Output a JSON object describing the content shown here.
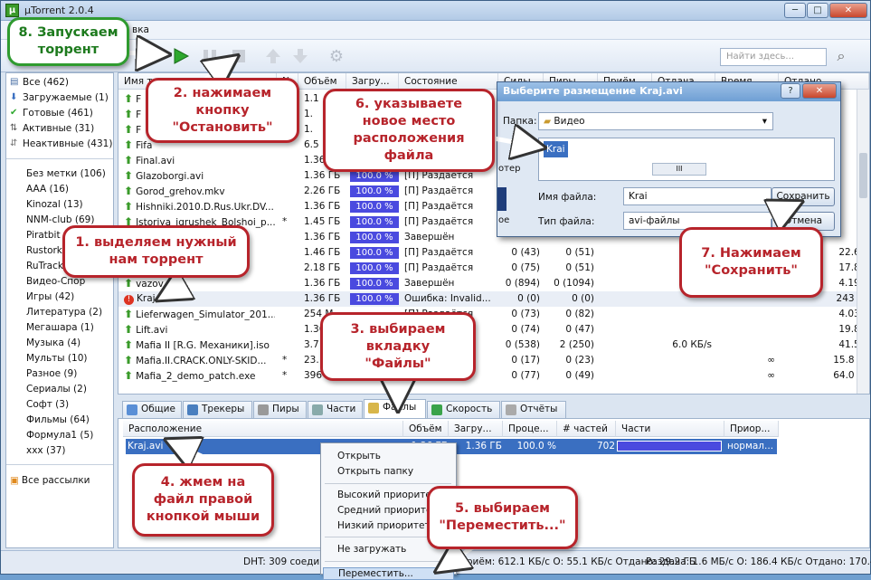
{
  "window": {
    "title": "µTorrent 2.0.4",
    "icon_letter": "μ",
    "minimize_label": "─",
    "maximize_label": "□",
    "close_label": "✕"
  },
  "menu": {
    "visible_item": "вка"
  },
  "toolbar": {
    "icons": [
      "remove-icon",
      "start-icon",
      "pause-icon",
      "stop-icon",
      "up-icon",
      "down-icon",
      "settings-icon"
    ],
    "search_placeholder": "Найти здесь...",
    "colors": {
      "start": "#2ea82e",
      "remove": "#d23a2a"
    }
  },
  "sidebar": {
    "status_items": [
      {
        "label": "Все (462)",
        "icon": "all-icon"
      },
      {
        "label": "Загружаемые (1)",
        "icon": "download-icon"
      },
      {
        "label": "Готовые (461)",
        "icon": "check-icon"
      },
      {
        "label": "Активные (31)",
        "icon": "active-icon"
      },
      {
        "label": "Неактивные (431)",
        "icon": "inactive-icon"
      }
    ],
    "label_items": [
      "Без метки (106)",
      "AAA (16)",
      "Kinozal (13)",
      "NNM-club (69)",
      "Piratbit (2",
      "Rustorka",
      "RuTracker",
      "Видео-Спор",
      "Игры (42)",
      "Литература (2)",
      "Мегашара (1)",
      "Музыка (4)",
      "Мульты (10)",
      "Разное (9)",
      "Сериалы (2)",
      "Софт (3)",
      "Фильмы (64)",
      "Формула1 (5)",
      "xxx (37)"
    ],
    "rss_label": "Все рассылки"
  },
  "torrents": {
    "headers": [
      "Имя торрента",
      "N",
      "Объём",
      "Загру...",
      "Состояние",
      "Сиды",
      "Пиры",
      "Приём",
      "Отдача",
      "Время",
      "Отдано"
    ],
    "rows": [
      {
        "name": "F",
        "num": "",
        "size": "1.1",
        "progress": "",
        "status": "",
        "seeds": "",
        "peers": "",
        "down": "",
        "up": "",
        "eta": "",
        "uploaded": "",
        "err": false
      },
      {
        "name": "F",
        "num": "",
        "size": "1.",
        "progress": "",
        "status": "",
        "seeds": "",
        "peers": "",
        "down": "",
        "up": "",
        "eta": "",
        "uploaded": "M",
        "err": false
      },
      {
        "name": "F",
        "num": "",
        "size": "1.",
        "progress": "",
        "status": "",
        "seeds": "",
        "peers": "",
        "down": "",
        "up": "",
        "eta": "",
        "uploaded": "",
        "err": false
      },
      {
        "name": "Fifa",
        "num": "",
        "size": "6.5",
        "progress": "",
        "status": "",
        "seeds": "",
        "peers": "",
        "down": "",
        "up": "",
        "eta": "",
        "uploaded": "M",
        "err": false
      },
      {
        "name": "Final.avi",
        "num": "",
        "size": "1.36 ГБ",
        "progress": "",
        "status": "",
        "seeds": "",
        "peers": "",
        "down": "",
        "up": "",
        "eta": "",
        "uploaded": "",
        "err": false
      },
      {
        "name": "Glazoborgi.avi",
        "num": "",
        "size": "1.36 ГБ",
        "progress": "100.0 %",
        "status": "[П] Раздаётся",
        "seeds": "",
        "peers": "",
        "down": "",
        "up": "",
        "eta": "",
        "uploaded": "",
        "err": false
      },
      {
        "name": "Gorod_grehov.mkv",
        "num": "",
        "size": "2.26 ГБ",
        "progress": "100.0 %",
        "status": "[П] Раздаётся",
        "seeds": "",
        "peers": "",
        "down": "",
        "up": "",
        "eta": "",
        "uploaded": "",
        "err": false
      },
      {
        "name": "Hishniki.2010.D.Rus.Ukr.DV...",
        "num": "",
        "size": "1.36 ГБ",
        "progress": "100.0 %",
        "status": "[П] Раздаётся",
        "seeds": "",
        "peers": "",
        "down": "",
        "up": "",
        "eta": "",
        "uploaded": "",
        "err": false
      },
      {
        "name": "Istoriya_igrushek_Bolshoi_p...",
        "num": "*",
        "size": "1.45 ГБ",
        "progress": "100.0 %",
        "status": "[П] Раздаётся",
        "seeds": "",
        "peers": "",
        "down": "",
        "up": "",
        "eta": "",
        "uploaded": "",
        "err": false
      },
      {
        "name": "",
        "num": "",
        "size": "1.36 ГБ",
        "progress": "100.0 %",
        "status": "Завершён",
        "seeds": "",
        "peers": "",
        "down": "",
        "up": "",
        "eta": "",
        "uploaded": "",
        "err": false
      },
      {
        "name": "",
        "num": "",
        "size": "1.46 ГБ",
        "progress": "100.0 %",
        "status": "[П] Раздаётся",
        "seeds": "0 (43)",
        "peers": "0 (51)",
        "down": "",
        "up": "",
        "eta": "",
        "uploaded": "22.6 l",
        "err": false
      },
      {
        "name": "",
        "num": "",
        "size": "2.18 ГБ",
        "progress": "100.0 %",
        "status": "[П] Раздаётся",
        "seeds": "0 (75)",
        "peers": "0 (51)",
        "down": "",
        "up": "",
        "eta": "",
        "uploaded": "17.8 l",
        "err": false
      },
      {
        "name": "vazov.avi",
        "num": "",
        "size": "1.36 ГБ",
        "progress": "100.0 %",
        "status": "Завершён",
        "seeds": "0 (894)",
        "peers": "0 (1094)",
        "down": "",
        "up": "",
        "eta": "",
        "uploaded": "4.19 l",
        "err": false
      },
      {
        "name": "Kraj.avi",
        "num": "",
        "size": "1.36 ГБ",
        "progress": "100.0 %",
        "status": "Ошибка: Invalid...",
        "seeds": "0 (0)",
        "peers": "0 (0)",
        "down": "",
        "up": "",
        "eta": "",
        "uploaded": "243 M",
        "err": true
      },
      {
        "name": "Lieferwagen_Simulator_201...",
        "num": "",
        "size": "254 M",
        "progress": "",
        "status": "[П] Раздаётся",
        "seeds": "0 (73)",
        "peers": "0 (82)",
        "down": "",
        "up": "",
        "eta": "",
        "uploaded": "4.03 l",
        "err": false
      },
      {
        "name": "Lift.avi",
        "num": "",
        "size": "1.36",
        "progress": "",
        "status": "",
        "seeds": "0 (74)",
        "peers": "0 (47)",
        "down": "",
        "up": "",
        "eta": "",
        "uploaded": "19.8 l",
        "err": false
      },
      {
        "name": "Mafia II [R.G. Механики].iso",
        "num": "",
        "size": "3.7",
        "progress": "",
        "status": "",
        "seeds": "0 (538)",
        "peers": "2 (250)",
        "down": "",
        "up": "6.0 КБ/s",
        "eta": "",
        "uploaded": "41.5 l",
        "err": false
      },
      {
        "name": "Mafia.II.CRACK.ONLY-SKID...",
        "num": "*",
        "size": "23.",
        "progress": "",
        "status": "",
        "seeds": "0 (17)",
        "peers": "0 (23)",
        "down": "",
        "up": "",
        "eta": "∞",
        "uploaded": "15.8 M",
        "err": false
      },
      {
        "name": "Mafia_2_demo_patch.exe",
        "num": "*",
        "size": "396",
        "progress": "",
        "status": "",
        "seeds": "0 (77)",
        "peers": "0 (49)",
        "down": "",
        "up": "",
        "eta": "∞",
        "uploaded": "64.0 M",
        "err": false
      }
    ]
  },
  "tabs": [
    "Общие",
    "Трекеры",
    "Пиры",
    "Части",
    "Файлы",
    "Скорость",
    "Отчёты"
  ],
  "active_tab": "Файлы",
  "files": {
    "headers": [
      "Расположение",
      "Объём",
      "Загру...",
      "Проце...",
      "# частей",
      "Части",
      "Приор..."
    ],
    "row": {
      "path": "Kraj.avi",
      "size": "1.36 ГБ",
      "done": "1.36 ГБ",
      "percent": "100.0 %",
      "pieces": "702",
      "priority": "нормал..."
    }
  },
  "context_menu": {
    "items": [
      "Открыть",
      "Открыть папку",
      "Высокий приоритет",
      "Средний приоритет",
      "Низкий приоритет",
      "Не загружать",
      "Переместить..."
    ]
  },
  "dialog": {
    "title": "Выберите размещение Kraj.avi",
    "help_label": "?",
    "close_label": "✕",
    "folder_label": "Папка:",
    "folder_value": "Видео",
    "selected_item": "Krai",
    "side_text_1": "отер",
    "side_text_2": "ое",
    "filename_label": "Имя файла:",
    "filename_value": "Krai",
    "filetype_label": "Тип файла:",
    "filetype_value": "avi-файлы",
    "save_label": "Сохранить",
    "cancel_label": "Отмена"
  },
  "status": {
    "dht": "DHT: 309 соедин",
    "left": "Приём: 612.1 КБ/с О: 55.1 КБ/с Отдано: 29.2 ГБ",
    "right": "Раздача: 1.6 МБ/с О: 186.4 КБ/с Отдано: 170.4"
  },
  "callouts": {
    "c1": "1. выделяем нужный\nнам торрент",
    "c2": "2. нажимаем\nкнопку\n\"Остановить\"",
    "c3": "3. выбираем\nвкладку\n\"Файлы\"",
    "c4": "4. жмем на\nфайл правой\nкнопкой мыши",
    "c5": "5. выбираем\n\"Переместить...\"",
    "c6": "6. указываете\nновое место\nрасположения\nфайла",
    "c7": "7. Нажимаем\n\"Сохранить\"",
    "c8": "8. Запускаем\nторрент"
  }
}
